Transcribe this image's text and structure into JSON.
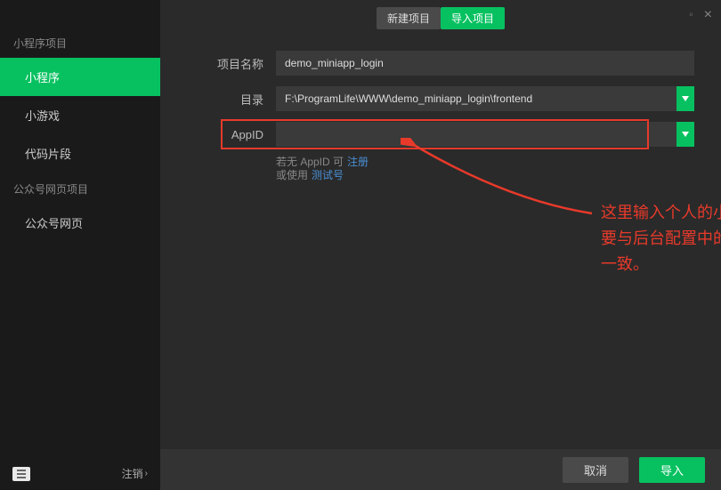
{
  "window": {
    "close": "×"
  },
  "sidebar": {
    "sections": [
      {
        "title": "小程序项目",
        "items": [
          "小程序",
          "小游戏",
          "代码片段"
        ]
      },
      {
        "title": "公众号网页项目",
        "items": [
          "公众号网页"
        ]
      }
    ],
    "active_item": "小程序",
    "logout": "注销"
  },
  "tabs": {
    "items": [
      "新建项目",
      "导入项目"
    ],
    "active": "导入项目"
  },
  "form": {
    "project_name_label": "项目名称",
    "project_name_value": "demo_miniapp_login",
    "dir_label": "目录",
    "dir_value": "F:\\ProgramLife\\WWW\\demo_miniapp_login\\frontend",
    "appid_label": "AppID",
    "appid_value": "",
    "hint1_prefix": "若无 AppID 可",
    "hint1_link": "注册",
    "hint2_prefix": "或使用",
    "hint2_link": "测试号"
  },
  "annotation": "这里输入个人的小程序Appid，要与后台配置中的小程序Appid一致。",
  "buttons": {
    "cancel": "取消",
    "import": "导入"
  }
}
